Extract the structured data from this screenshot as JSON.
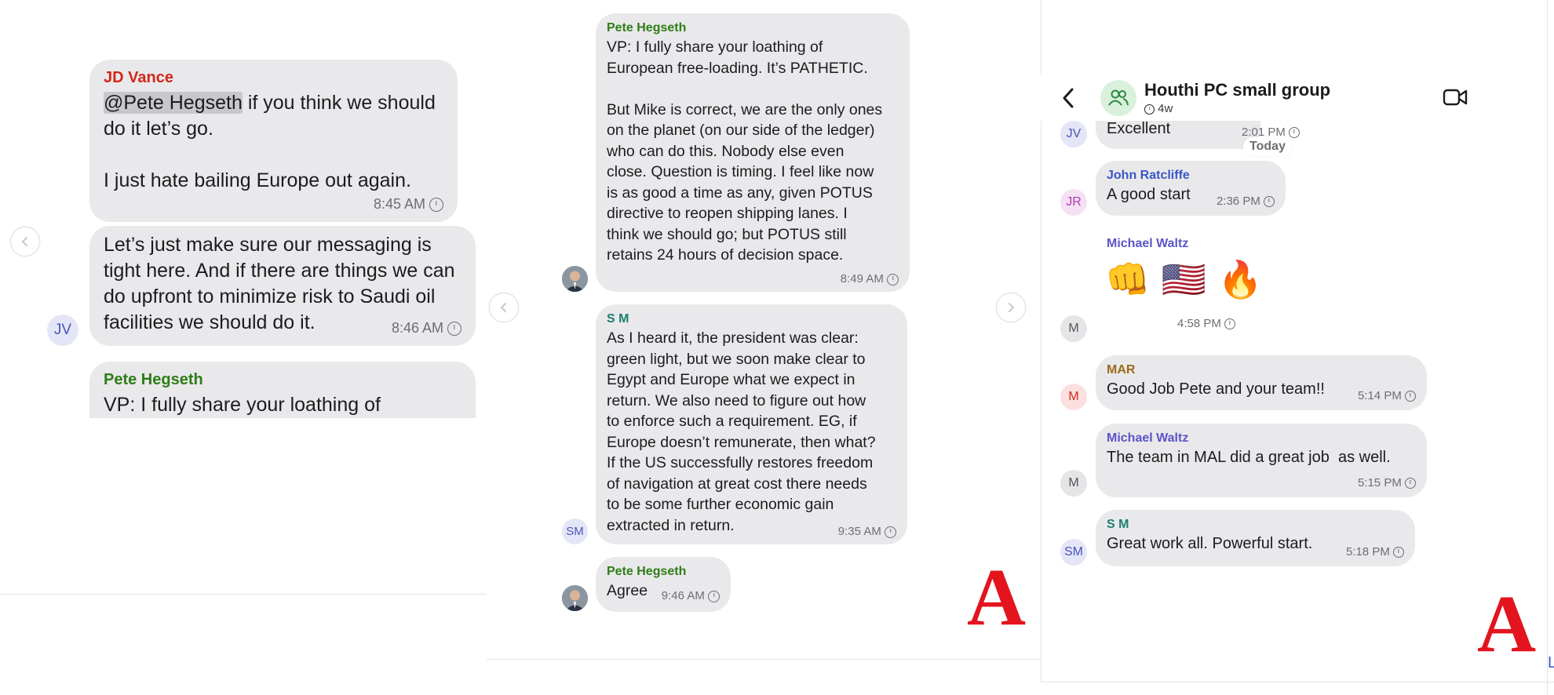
{
  "panel1": {
    "messages": [
      {
        "sender": "JD Vance",
        "mention": "@Pete Hegseth",
        "text_after_mention": " if you think we should\ndo it let’s go.\n\nI just hate bailing Europe out again.",
        "time": "8:45 AM"
      },
      {
        "text": "Let’s just make sure our messaging is\ntight here. And if there are things we can\ndo upfront to minimize risk to Saudi oil\nfacilities we should do it.",
        "time": "8:46 AM",
        "avatar": "JV"
      },
      {
        "sender": "Pete Hegseth",
        "text": "VP: I fully share your loathing of"
      }
    ]
  },
  "panel2": {
    "messages": [
      {
        "sender": "Pete Hegseth",
        "text": "VP: I fully share your loathing of\nEuropean free-loading. It’s PATHETIC.\n\nBut Mike is correct, we are the only ones\non the planet (on our side of the ledger)\nwho can do this. Nobody else even\nclose. Question is timing. I feel like now\nis as good a time as any, given POTUS\ndirective to reopen shipping lanes. I\nthink we should go; but POTUS still\nretains 24 hours of decision space.",
        "time": "8:49 AM"
      },
      {
        "sender": "S M",
        "text": "As I heard it, the president was clear:\ngreen light, but we soon make clear to\nEgypt and Europe what we expect in\nreturn. We also need to figure out how\nto enforce such a requirement. EG, if\nEurope doesn’t remunerate, then what?\nIf the US successfully restores freedom\nof navigation at great cost there needs\nto be some further economic gain\nextracted in return.",
        "time": "9:35 AM",
        "avatar": "SM"
      },
      {
        "sender": "Pete Hegseth",
        "text": "Agree",
        "time": "9:46 AM"
      }
    ],
    "logo": "A"
  },
  "panel3": {
    "header": {
      "title": "Houthi PC small group",
      "subtitle": "4w"
    },
    "prev_message": {
      "avatar": "JV",
      "text": "Excellent",
      "time": "2:01 PM"
    },
    "day_label": "Today",
    "messages": [
      {
        "avatar": "JR",
        "sender": "John Ratcliffe",
        "text": "A good start",
        "time": "2:36 PM"
      },
      {
        "avatar": "M",
        "sender": "Michael Waltz",
        "emojis": "👊 🇺🇸 🔥",
        "time": "4:58 PM"
      },
      {
        "avatar": "M",
        "sender": "MAR",
        "text": "Good Job Pete and your team!!",
        "time": "5:14 PM"
      },
      {
        "avatar": "M",
        "sender": "Michael Waltz",
        "text": "The team in MAL did a great job  as well.",
        "time": "5:15 PM"
      },
      {
        "avatar": "SM",
        "sender": "S M",
        "text": "Great work all. Powerful start.",
        "time": "5:18 PM"
      }
    ],
    "logo": "A",
    "edge_letter": "L"
  },
  "colors": {
    "bubble": "#e9e9eb",
    "pete": "#2e7d17",
    "vance": "#d3271c",
    "sm": "#1b7f70",
    "ratcliffe": "#3b57c4",
    "waltz": "#5b55c8",
    "mar": "#9c6a1a",
    "logo": "#e3141e"
  },
  "icons": [
    "clock-icon",
    "back-chevron-icon",
    "group-icon",
    "video-call-icon",
    "prev-arrow-icon",
    "next-arrow-icon"
  ]
}
